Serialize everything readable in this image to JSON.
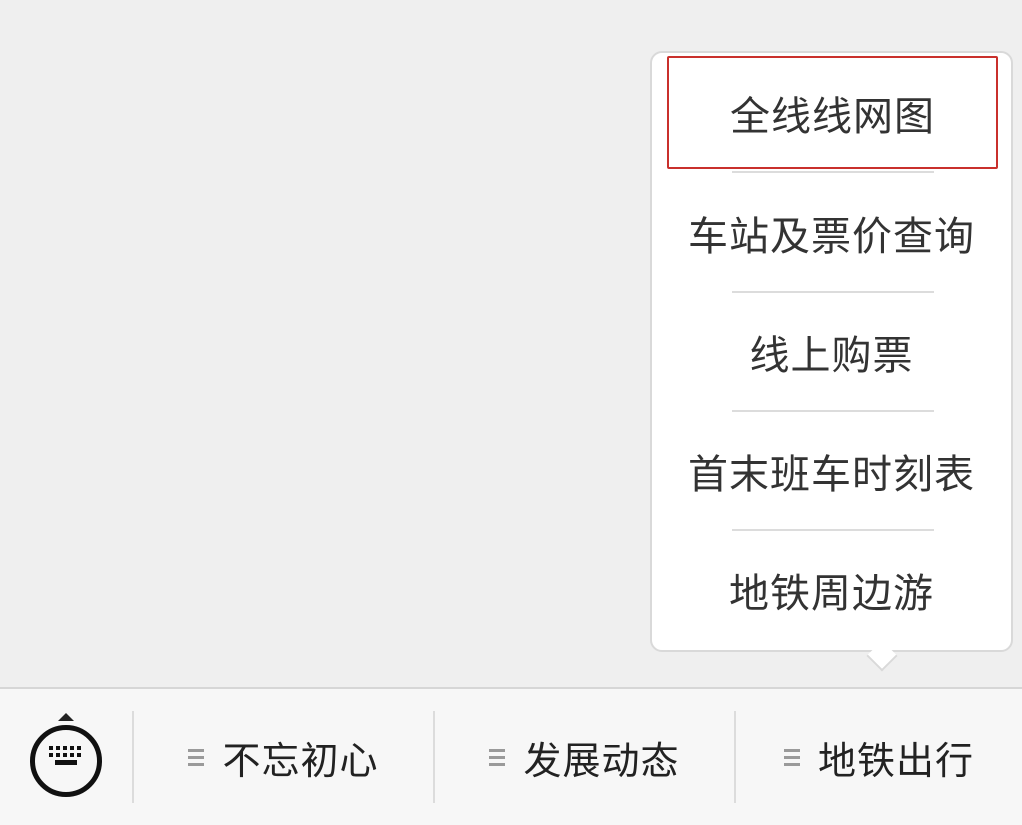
{
  "popup": {
    "items": [
      {
        "label": "全线线网图",
        "selected": true
      },
      {
        "label": "车站及票价查询",
        "selected": false
      },
      {
        "label": "线上购票",
        "selected": false
      },
      {
        "label": "首末班车时刻表",
        "selected": false
      },
      {
        "label": "地铁周边游",
        "selected": false
      }
    ],
    "highlight_color": "#c9302c"
  },
  "menubar": {
    "keyboard_icon": "keyboard-icon",
    "tabs": [
      {
        "label": "不忘初心",
        "icon": "menu-lines-icon"
      },
      {
        "label": "发展动态",
        "icon": "menu-lines-icon"
      },
      {
        "label": "地铁出行",
        "icon": "menu-lines-icon",
        "active": true
      }
    ]
  }
}
